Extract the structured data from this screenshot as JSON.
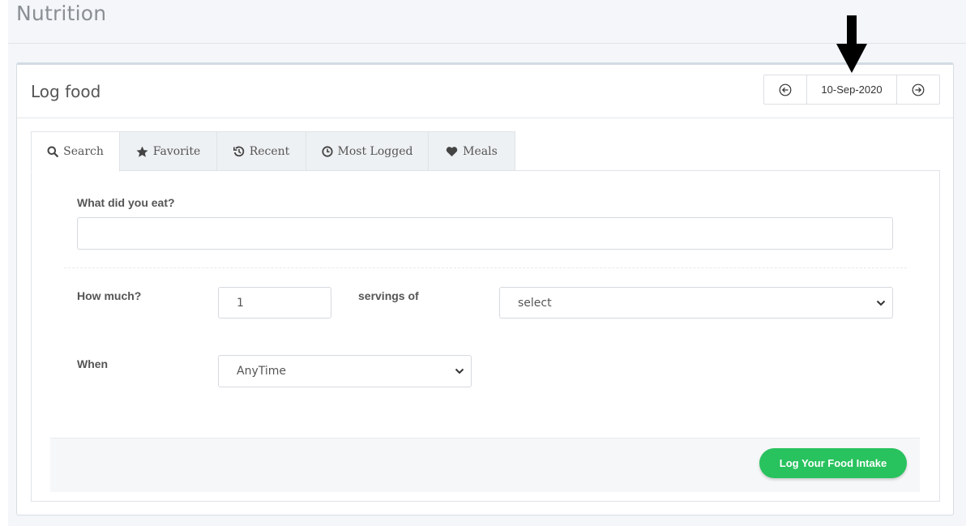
{
  "page": {
    "title": "Nutrition"
  },
  "card": {
    "title": "Log food",
    "date_nav": {
      "date": "10-Sep-2020",
      "prev_icon": "arrow-left-circle-icon",
      "next_icon": "arrow-right-circle-icon"
    }
  },
  "tabs": [
    {
      "label": "Search",
      "icon": "search-icon",
      "active": true
    },
    {
      "label": "Favorite",
      "icon": "star-icon",
      "active": false
    },
    {
      "label": "Recent",
      "icon": "history-icon",
      "active": false
    },
    {
      "label": "Most Logged",
      "icon": "clock-icon",
      "active": false
    },
    {
      "label": "Meals",
      "icon": "heart-icon",
      "active": false
    }
  ],
  "form": {
    "food_label": "What did you eat?",
    "food_value": "",
    "how_much_label": "How much?",
    "quantity_value": "1",
    "servings_label": "servings of",
    "serving_select_value": "select",
    "when_label": "When",
    "when_select_value": "AnyTime"
  },
  "actions": {
    "log_button": "Log Your Food Intake"
  },
  "colors": {
    "accent_green": "#28c25e",
    "page_bg": "#f4f6f9"
  }
}
